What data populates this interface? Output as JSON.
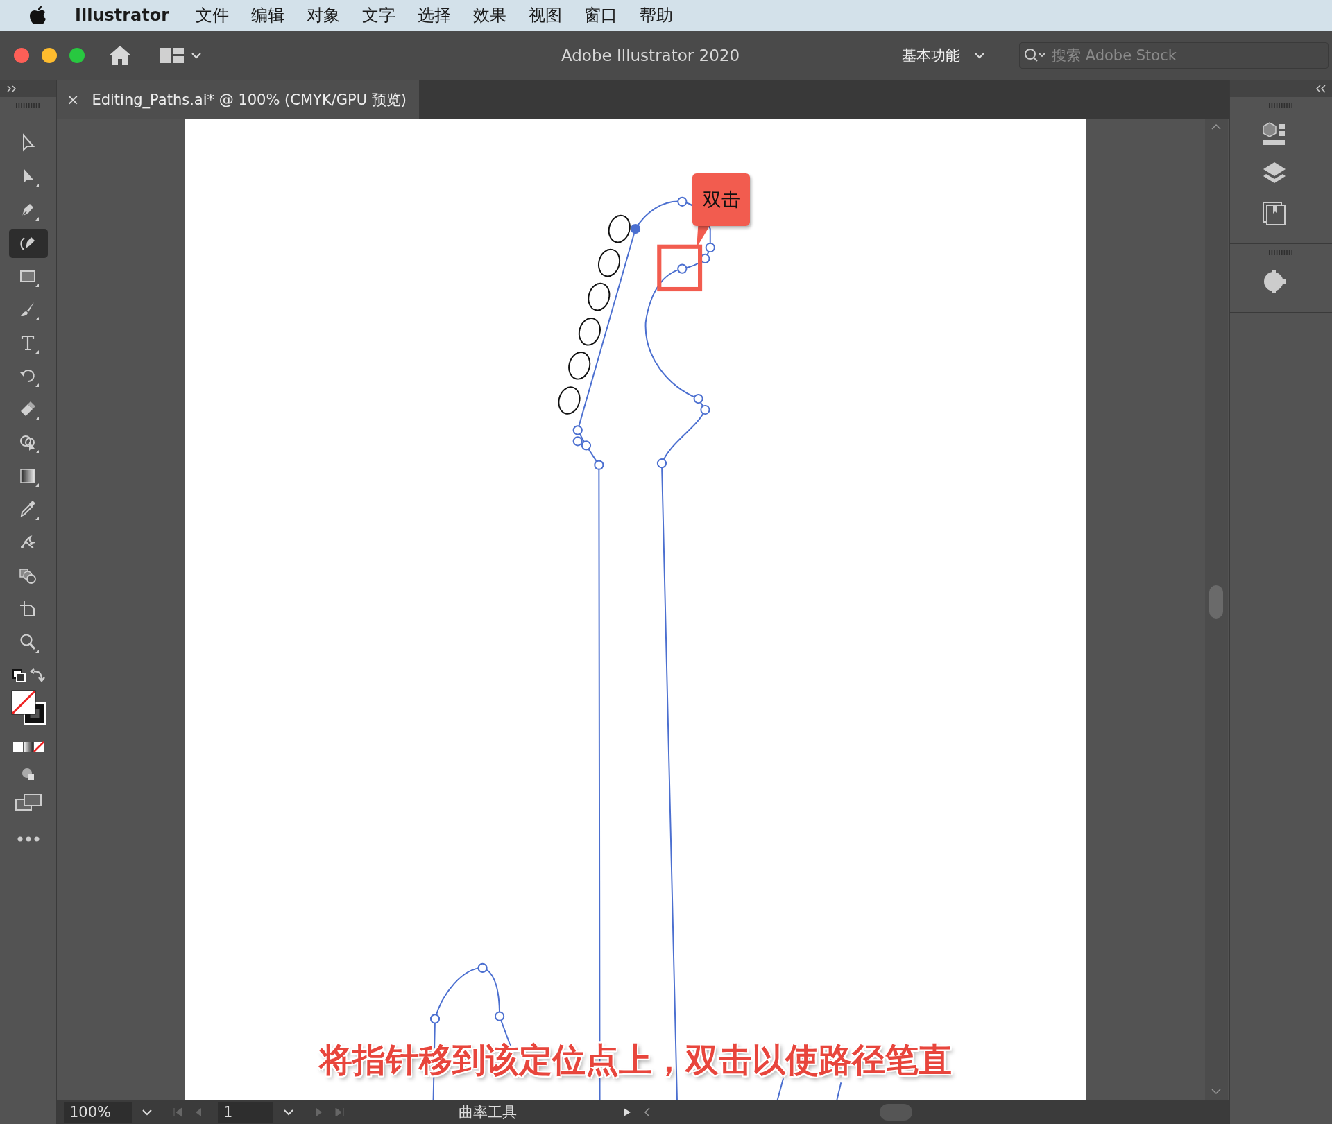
{
  "menu_bar": {
    "app": "Illustrator",
    "items": [
      "文件",
      "编辑",
      "对象",
      "文字",
      "选择",
      "效果",
      "视图",
      "窗口",
      "帮助"
    ]
  },
  "title_bar": {
    "title": "Adobe Illustrator 2020",
    "workspace": "基本功能",
    "search": {
      "placeholder": "搜索 Adobe Stock"
    }
  },
  "document_tab": {
    "close": "×",
    "title": "Editing_Paths.ai* @ 100% (CMYK/GPU 预览)"
  },
  "tools": [
    {
      "kind": "selection",
      "selected": false
    },
    {
      "kind": "direct-selection",
      "selected": false
    },
    {
      "kind": "pen",
      "selected": false
    },
    {
      "kind": "curvature",
      "selected": true
    },
    {
      "kind": "rectangle",
      "selected": false
    },
    {
      "kind": "paintbrush",
      "selected": false
    },
    {
      "kind": "type",
      "selected": false
    },
    {
      "kind": "rotate",
      "selected": false
    },
    {
      "kind": "eraser",
      "selected": false
    },
    {
      "kind": "shape-builder",
      "selected": false
    },
    {
      "kind": "gradient",
      "selected": false
    },
    {
      "kind": "eyedropper",
      "selected": false
    },
    {
      "kind": "puppet-warp",
      "selected": false
    },
    {
      "kind": "blend",
      "selected": false
    },
    {
      "kind": "artboard",
      "selected": false
    },
    {
      "kind": "zoom",
      "selected": false
    }
  ],
  "canvas": {
    "callout": "双击",
    "caption": "将指针移到该定位点上，双击以使路径笔直"
  },
  "status_bar": {
    "zoom": "100%",
    "artboard": "1",
    "tool": "曲率工具"
  }
}
